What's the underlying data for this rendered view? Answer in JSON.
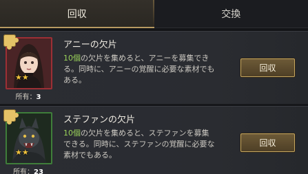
{
  "tabs": [
    {
      "label": "回収",
      "active": true
    },
    {
      "label": "交換",
      "active": false
    }
  ],
  "items": [
    {
      "title": "アニーの欠片",
      "desc_highlight": "10個",
      "desc_rest": "の欠片を集めると、アニーを募集できる。同時に、アニーの覚醒に必要な素材でもある。",
      "owned_label": "所有：",
      "owned_count": "3",
      "stars": "★★",
      "button_label": "回収",
      "frame_color": "#9d2f35"
    },
    {
      "title": "ステファンの欠片",
      "desc_highlight": "10個",
      "desc_rest": "の欠片を集めると、ステファンを募集できる。同時に、ステファンの覚醒に必要な素材でもある。",
      "owned_label": "所有：",
      "owned_count": "23",
      "stars": "★★",
      "button_label": "回収",
      "frame_color": "#3f7e3a"
    }
  ],
  "colors": {
    "accent_gold": "#c7a860",
    "highlight_green": "#9bd35a"
  }
}
